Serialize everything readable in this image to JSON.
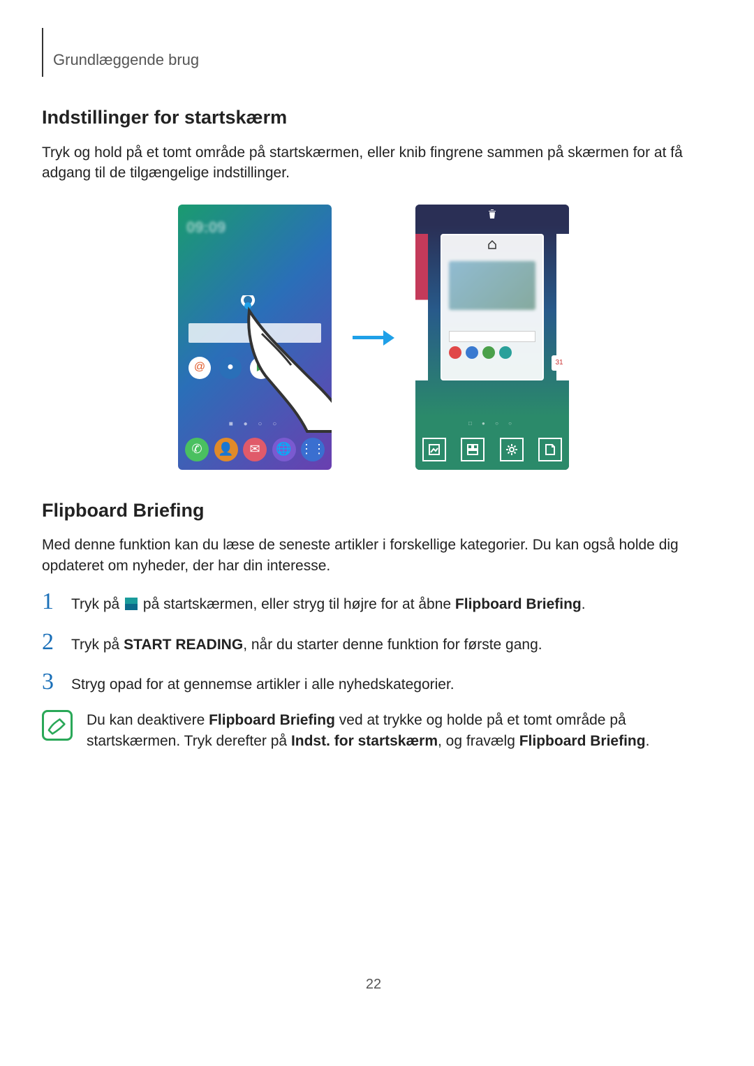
{
  "header": {
    "breadcrumb": "Grundlæggende brug"
  },
  "section1": {
    "heading": "Indstillinger for startskærm",
    "body": "Tryk og hold på et tomt område på startskærmen, eller knib fingrene sammen på skærmen for at få adgang til de tilgængelige indstillinger."
  },
  "phone_left": {
    "clock": "09:09",
    "app_icons": [
      "@",
      "globe",
      "play"
    ],
    "dock_icons": [
      "phone",
      "person",
      "mail",
      "globe",
      "grid"
    ]
  },
  "phone_right": {
    "trash_icon": "trash",
    "home_icon": "home",
    "mini_app_colors": [
      "#e04848",
      "#3a7ad0",
      "#4aa04a",
      "#2aa09a"
    ],
    "calendar_badge": "31",
    "toolbar_icons": [
      "image",
      "widgets",
      "settings",
      "page"
    ]
  },
  "section2": {
    "heading": "Flipboard Briefing",
    "body": "Med denne funktion kan du læse de seneste artikler i forskellige kategorier. Du kan også holde dig opdateret om nyheder, der har din interesse."
  },
  "steps": [
    {
      "num": "1",
      "pre": "Tryk på ",
      "post": " på startskærmen, eller stryg til højre for at åbne ",
      "bold1": "Flipboard Briefing",
      "tail": "."
    },
    {
      "num": "2",
      "pre": "Tryk på ",
      "bold1": "START READING",
      "post": ", når du starter denne funktion for første gang."
    },
    {
      "num": "3",
      "pre": "Stryg opad for at gennemse artikler i alle nyhedskategorier."
    }
  ],
  "note": {
    "pre": "Du kan deaktivere ",
    "bold1": "Flipboard Briefing",
    "mid1": " ved at trykke og holde på et tomt område på startskærmen. Tryk derefter på ",
    "bold2": "Indst. for startskærm",
    "mid2": ", og fravælg ",
    "bold3": "Flipboard Briefing",
    "tail": "."
  },
  "page_number": "22"
}
